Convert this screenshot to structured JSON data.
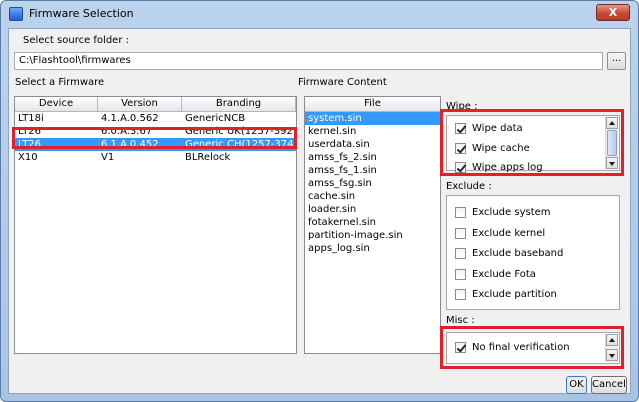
{
  "window": {
    "title": "Firmware Selection",
    "close_label": "X"
  },
  "source": {
    "label": "Select source folder :",
    "path": "C:\\Flashtool\\firmwares",
    "browse_label": "..."
  },
  "firmware_list": {
    "label": "Select a Firmware",
    "columns": [
      "Device",
      "Version",
      "Branding"
    ],
    "rows": [
      [
        "LT18i",
        "4.1.A.0.562",
        "GenericNCB"
      ],
      [
        "LT26",
        "6.0.A.3.67",
        "Generic UK(1257-3921)"
      ],
      [
        "LT26",
        "6.1.A.0.452",
        "Generic CH(1257-3740)"
      ],
      [
        "X10",
        "V1",
        "BLRelock"
      ]
    ],
    "selected_index": 2
  },
  "firmware_content": {
    "label": "Firmware Content",
    "column": "File",
    "files": [
      "system.sin",
      "kernel.sin",
      "userdata.sin",
      "amss_fs_2.sin",
      "amss_fs_1.sin",
      "amss_fsg.sin",
      "cache.sin",
      "loader.sin",
      "fotakernel.sin",
      "partition-image.sin",
      "apps_log.sin"
    ],
    "selected_index": 0
  },
  "wipe": {
    "label": "Wipe :",
    "options": [
      {
        "label": "Wipe data",
        "checked": true
      },
      {
        "label": "Wipe cache",
        "checked": true
      },
      {
        "label": "Wipe apps log",
        "checked": true
      }
    ]
  },
  "exclude": {
    "label": "Exclude :",
    "options": [
      {
        "label": "Exclude system",
        "checked": false
      },
      {
        "label": "Exclude kernel",
        "checked": false
      },
      {
        "label": "Exclude baseband",
        "checked": false
      },
      {
        "label": "Exclude Fota",
        "checked": false
      },
      {
        "label": "Exclude partition",
        "checked": false
      }
    ]
  },
  "misc": {
    "label": "Misc :",
    "options": [
      {
        "label": "No final verification",
        "checked": true
      }
    ]
  },
  "buttons": {
    "ok": "OK",
    "cancel": "Cancel"
  },
  "colors": {
    "selection": "#3399ff",
    "highlight": "#e0202a"
  }
}
